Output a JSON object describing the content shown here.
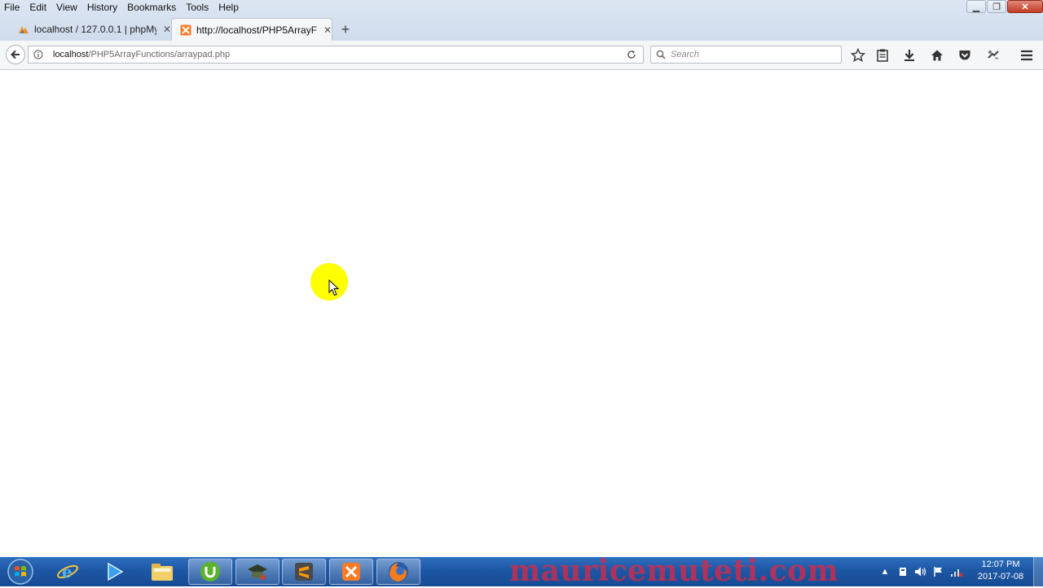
{
  "menubar": {
    "items": [
      "File",
      "Edit",
      "View",
      "History",
      "Bookmarks",
      "Tools",
      "Help"
    ]
  },
  "window_controls": {
    "minimize": "▁",
    "maximize": "❐",
    "close": "✕"
  },
  "tabs": [
    {
      "title": "localhost / 127.0.0.1 | phpMy",
      "icon": "phpmyadmin-icon",
      "active": false
    },
    {
      "title": "http://localhost/PHP5ArrayF",
      "icon": "xampp-icon",
      "active": true
    }
  ],
  "new_tab": "+",
  "navbar": {
    "url_host": "localhost",
    "url_path": "/PHP5ArrayFunctions/arraypad.php",
    "search_placeholder": "Search",
    "toolbar_icons": [
      "bookmark-star-icon",
      "reading-list-icon",
      "download-icon",
      "home-icon",
      "pocket-icon",
      "extension-icon",
      "hamburger-menu-icon"
    ]
  },
  "taskbar": {
    "apps": [
      "internet-explorer-icon",
      "media-player-icon",
      "file-explorer-icon",
      "utorrent-icon",
      "graduation-app-icon",
      "sublime-text-icon",
      "xampp-icon",
      "firefox-icon"
    ],
    "watermark": "mauricemuteti.com",
    "clock_time": "12:07 PM",
    "clock_date": "2017-07-08"
  },
  "colors": {
    "taskbar": "#1d57a4",
    "cursor_highlight": "#ffff00",
    "watermark": "#de2846"
  }
}
